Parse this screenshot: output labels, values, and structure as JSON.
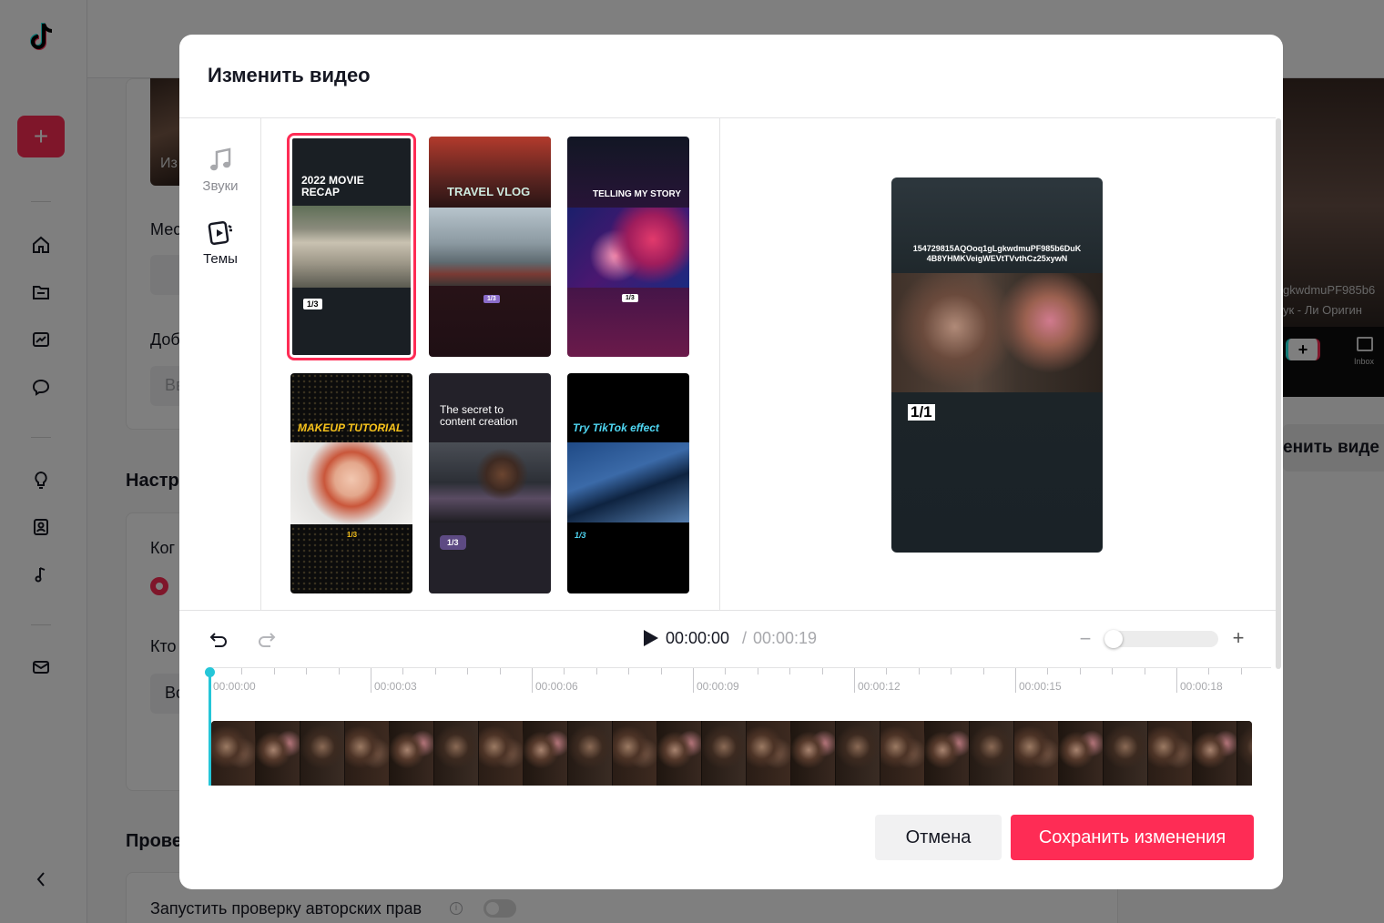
{
  "modal": {
    "title": "Изменить видео",
    "nav": [
      {
        "label": "Звуки",
        "icon": "music-note-icon"
      },
      {
        "label": "Темы",
        "icon": "themes-icon"
      }
    ],
    "themes": [
      {
        "title": "2022 MOVIE RECAP",
        "badge": "1/3",
        "selected": true
      },
      {
        "title": "TRAVEL VLOG",
        "badge": "1/3",
        "selected": false
      },
      {
        "title": "TELLING MY STORY",
        "badge": "1/3",
        "selected": false
      },
      {
        "title": "MAKEUP TUTORIAL",
        "badge": "1/3",
        "selected": false
      },
      {
        "title": "The secret to content creation",
        "badge": "1/3",
        "selected": false
      },
      {
        "title": "Try TikTok effect",
        "badge": "1/3",
        "selected": false
      }
    ],
    "preview": {
      "caption": "154729815AQOoq1gLgkwdmuPF985b6DuK 4B8YHMKVeigWEVtTVvthCz25xywN",
      "badge": "1/1"
    },
    "player": {
      "current_time": "00:00:00",
      "separator": "/",
      "total_time": "00:00:19",
      "zoom_minus": "−",
      "zoom_plus": "+",
      "zoom_level": 0
    },
    "timeline": {
      "labels": [
        "00:00:00",
        "00:00:03",
        "00:00:06",
        "00:00:09",
        "00:00:12",
        "00:00:15",
        "00:00:18"
      ]
    },
    "buttons": {
      "cancel": "Отмена",
      "save": "Сохранить изменения"
    }
  },
  "background": {
    "partial_texts": {
      "thumb": "Из",
      "field1": "Мес",
      "field2": "Доб",
      "field2_input": "Вв",
      "settings": "Настр",
      "when": "Ког",
      "who": "Кто",
      "who_input": "Во",
      "check": "Прове",
      "copyright": "Запустить проверку авторских прав"
    },
    "right": {
      "caption1": "gkwdmuPF985b6",
      "caption2": "ук - Ли   Оригин",
      "inbox": "Inbox",
      "edit_video": "енить виде"
    }
  },
  "colors": {
    "accent": "#fe2c55",
    "playhead": "#25c6d8"
  }
}
